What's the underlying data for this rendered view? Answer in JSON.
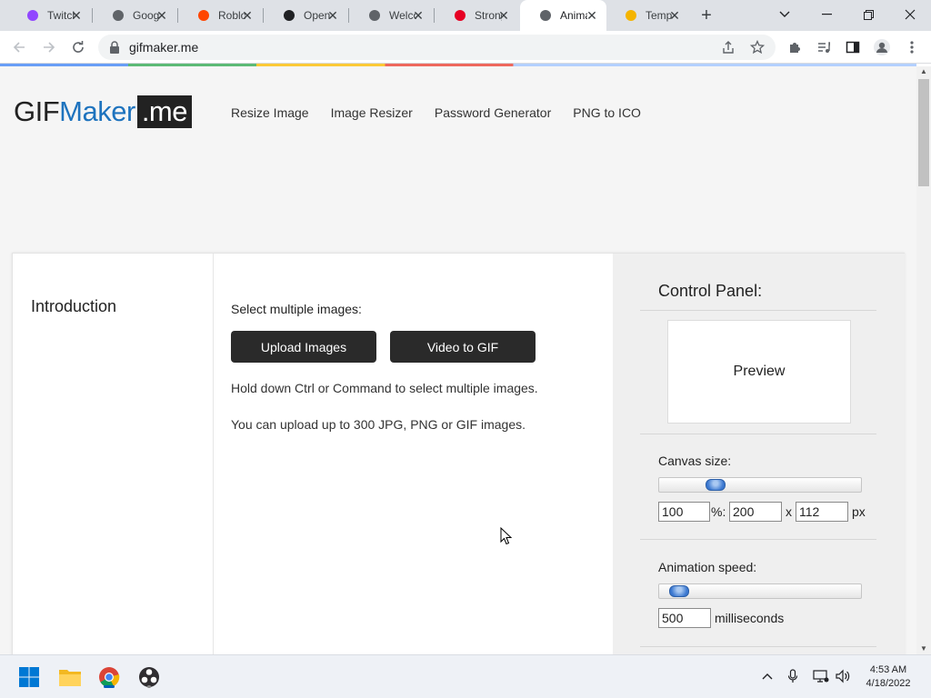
{
  "browser": {
    "tabs": [
      {
        "title": "Twitch",
        "icon": "twitch-icon",
        "color": "#9146ff"
      },
      {
        "title": "Google",
        "icon": "globe-icon",
        "color": "#5f6368"
      },
      {
        "title": "Roblox",
        "icon": "reddit-icon",
        "color": "#ff4500"
      },
      {
        "title": "Open",
        "icon": "obs-icon",
        "color": "#202124"
      },
      {
        "title": "Welcome",
        "icon": "globe-icon",
        "color": "#5f6368"
      },
      {
        "title": "Strong",
        "icon": "pinterest-icon",
        "color": "#e60023"
      },
      {
        "title": "Animated",
        "icon": "globe-icon",
        "color": "#5f6368"
      },
      {
        "title": "Template",
        "icon": "cake-icon",
        "color": "#f4b400"
      }
    ],
    "active_tab": 6,
    "url": "gifmaker.me"
  },
  "site": {
    "logo": {
      "part1": "GIF",
      "part2": "Maker",
      "part3": ".me"
    },
    "nav": [
      "Resize Image",
      "Image Resizer",
      "Password Generator",
      "PNG to ICO"
    ]
  },
  "main": {
    "intro": "Introduction",
    "select_label": "Select multiple images:",
    "upload_button": "Upload Images",
    "video_button": "Video to GIF",
    "hint1": "Hold down Ctrl or Command to select multiple images.",
    "hint2": "You can upload up to 300 JPG, PNG or GIF images."
  },
  "control_panel": {
    "title": "Control Panel:",
    "preview": "Preview",
    "canvas_label": "Canvas size:",
    "canvas_slider_fraction": 0.28,
    "canvas_percent": "100",
    "percent_sep": "%:",
    "width": "200",
    "times": "x",
    "height": "112",
    "px": "px",
    "speed_label": "Animation speed:",
    "speed_slider_fraction": 0.1,
    "speed_value": "500",
    "speed_unit": "milliseconds"
  },
  "taskbar": {
    "time": "4:53 AM",
    "date": "4/18/2022"
  }
}
